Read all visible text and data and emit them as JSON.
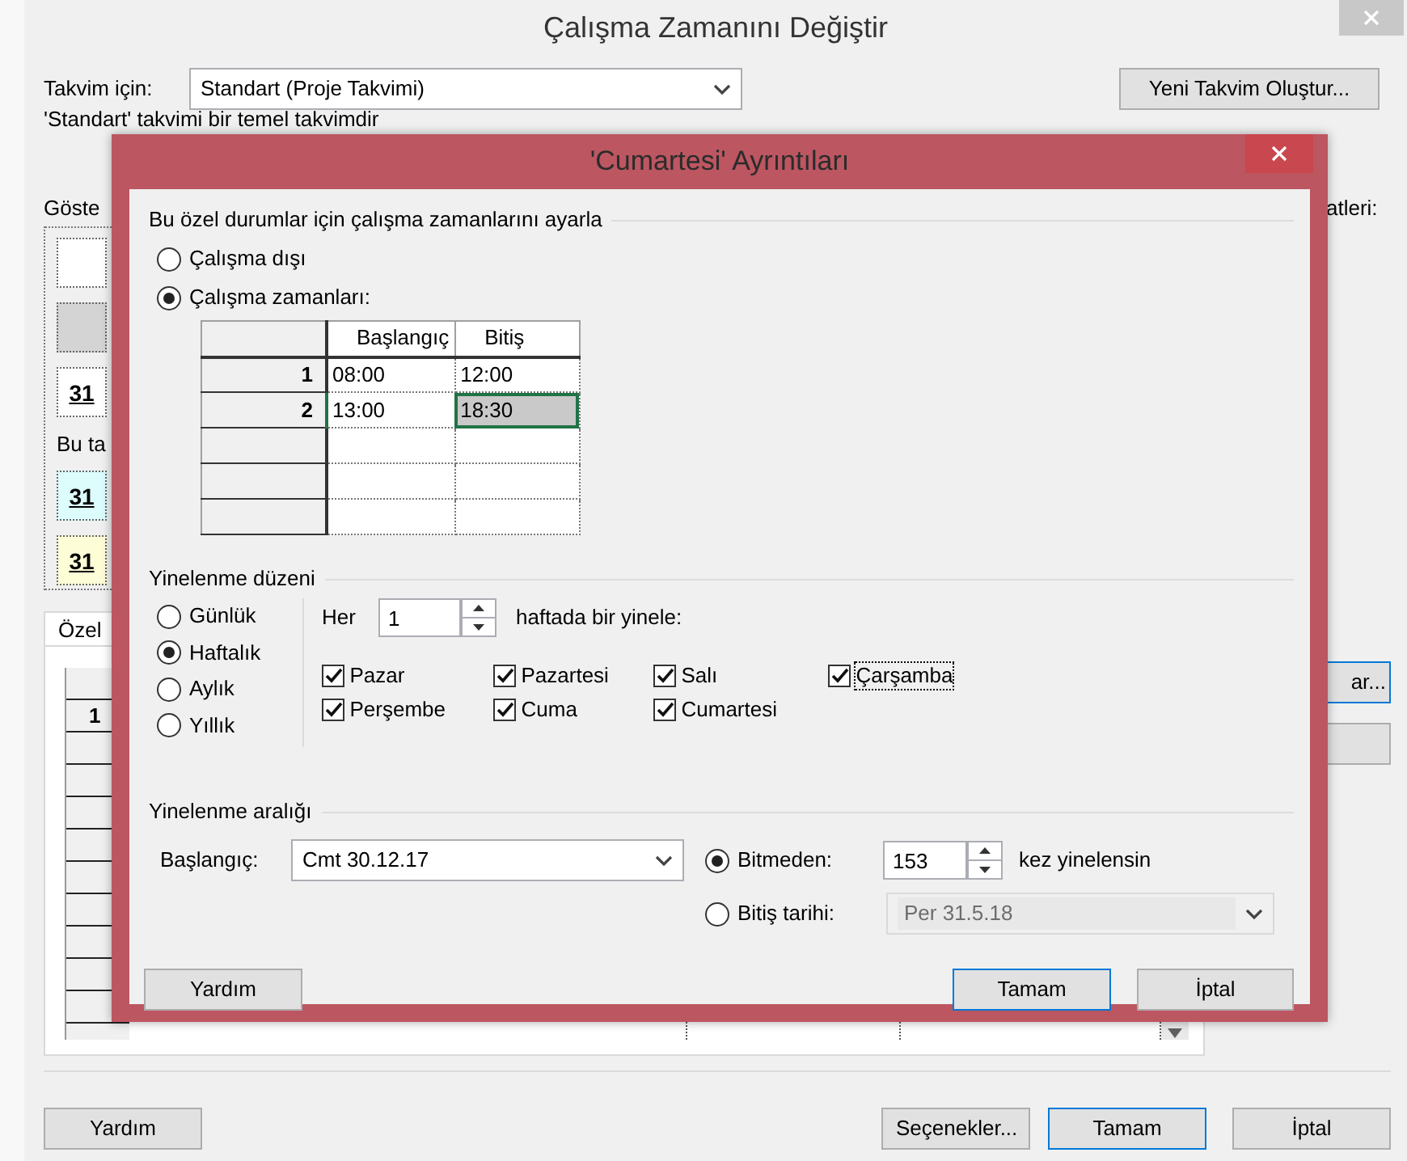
{
  "main_window": {
    "title": "Çalışma Zamanını Değiştir"
  },
  "calendar": {
    "label": "Takvim için:",
    "value": "Standart (Proje Takvimi)",
    "new_button": "Yeni Takvim Oluştur...",
    "note": "'Standart' takvimi bir temel takvimdir"
  },
  "legend": {
    "heading": "Göste",
    "groups": [
      {
        "items": [
          {
            "color": "#ffffff"
          },
          {
            "color": "#d4d4d4"
          },
          {
            "label": "31",
            "color": "#ffffff"
          }
        ]
      },
      {
        "heading": "Bu ta",
        "items": [
          {
            "label": "31",
            "color": "#ddfdfd"
          },
          {
            "label": "31",
            "color": "#fdfdd8"
          }
        ]
      }
    ]
  },
  "right_panel": {
    "heading": "atleri:",
    "buttons": [
      {
        "label": "ar...",
        "focused": true
      },
      {
        "focused": false
      }
    ]
  },
  "tabs": [
    {
      "label": "Özel",
      "selected": true
    }
  ],
  "exceptions_table": {
    "rows": [
      {
        "number": "1"
      }
    ]
  },
  "footer_buttons": [
    {
      "label": "Yardım",
      "focused": false
    },
    {
      "label": "Seçenekler...",
      "focused": false
    },
    {
      "label": "Tamam",
      "focused": true
    },
    {
      "label": "İptal",
      "focused": false
    }
  ],
  "details_dialog": {
    "title": "'Cumartesi' Ayrıntıları",
    "working_times": {
      "heading": "Bu özel durumlar için çalışma zamanlarını ayarla",
      "options": [
        {
          "label": "Çalışma dışı",
          "selected": false
        },
        {
          "label": "Çalışma zamanları:",
          "selected": true
        }
      ],
      "table": {
        "columns": [
          "Başlangıç",
          "Bitiş"
        ],
        "rows": [
          {
            "number": "1",
            "cells": [
              {
                "value": "08:00",
                "selected": false
              },
              {
                "value": "12:00",
                "selected": false
              }
            ]
          },
          {
            "number": "2",
            "cells": [
              {
                "value": "13:00",
                "selected": false
              },
              {
                "value": "18:30",
                "selected": true
              }
            ]
          }
        ]
      }
    },
    "recurrence_pattern": {
      "heading": "Yinelenme düzeni",
      "options": [
        {
          "label": "Günlük",
          "selected": false
        },
        {
          "label": "Haftalık",
          "selected": true
        },
        {
          "label": "Aylık",
          "selected": false
        },
        {
          "label": "Yıllık",
          "selected": false
        }
      ],
      "every_label": "Her",
      "every_value": "1",
      "every_suffix": "haftada bir yinele:",
      "days": [
        {
          "label": "Pazar",
          "checked": true,
          "focused": false
        },
        {
          "label": "Pazartesi",
          "checked": true,
          "focused": false
        },
        {
          "label": "Salı",
          "checked": true,
          "focused": false
        },
        {
          "label": "Çarşamba",
          "checked": true,
          "focused": true
        },
        {
          "label": "Perşembe",
          "checked": true,
          "focused": false
        },
        {
          "label": "Cuma",
          "checked": true,
          "focused": false
        },
        {
          "label": "Cumartesi",
          "checked": true,
          "focused": false
        }
      ]
    },
    "recurrence_range": {
      "heading": "Yinelenme aralığı",
      "start_label": "Başlangıç:",
      "start_value": "Cmt 30.12.17",
      "end_options": [
        {
          "kind": "count",
          "label": "Bitmeden:",
          "selected": true,
          "value": "153",
          "suffix": "kez yinelensin"
        },
        {
          "kind": "date",
          "label": "Bitiş tarihi:",
          "selected": false,
          "value": "Per 31.5.18",
          "disabled": true
        }
      ]
    },
    "buttons": [
      {
        "label": "Yardım",
        "focused": false
      },
      {
        "label": "Tamam",
        "focused": true
      },
      {
        "label": "İptal",
        "focused": false
      }
    ]
  }
}
